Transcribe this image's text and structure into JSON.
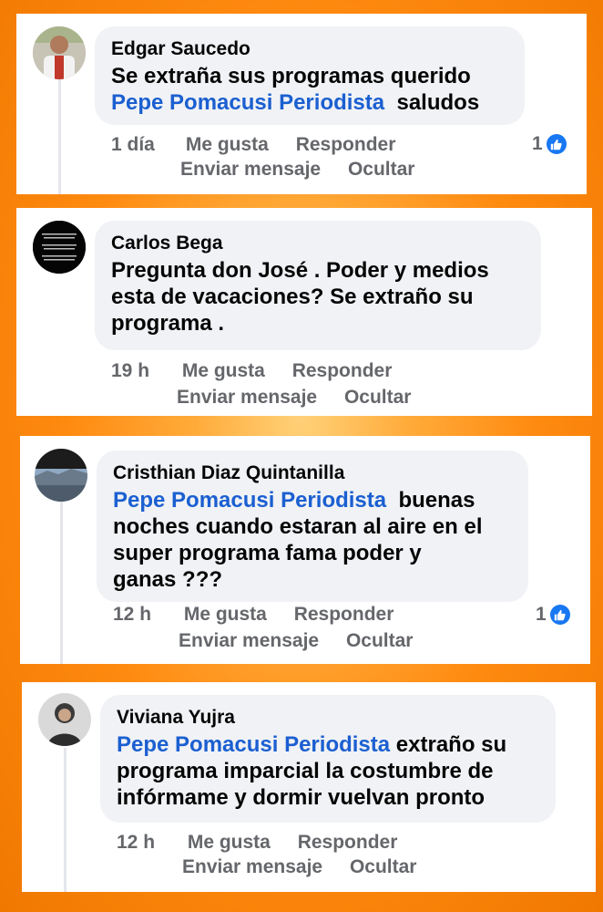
{
  "comments": [
    {
      "author": "Edgar Saucedo",
      "text_before": "Se extraña sus programas querido",
      "mention": "Pepe Pomacusi Periodista",
      "text_after": "saludos",
      "time": "1 día",
      "like": "Me gusta",
      "reply": "Responder",
      "send": "Enviar mensaje",
      "hide": "Ocultar",
      "reactions": "1"
    },
    {
      "author": "Carlos Bega",
      "text": "Pregunta don José . Poder y medios esta de vacaciones? Se extraño su programa .",
      "text_lines": [
        "Pregunta don José . Poder y medios",
        "esta de vacaciones? Se extraño su",
        "programa ."
      ],
      "time": "19 h",
      "like": "Me gusta",
      "reply": "Responder",
      "send": "Enviar mensaje",
      "hide": "Ocultar"
    },
    {
      "author": "Cristhian Diaz Quintanilla",
      "mention": "Pepe Pomacusi Periodista",
      "text_after_1": "buenas",
      "text_lines": [
        "noches cuando estaran al aire en el",
        "super programa fama poder y",
        "ganas ???"
      ],
      "time": "12 h",
      "like": "Me gusta",
      "reply": "Responder",
      "send": "Enviar mensaje",
      "hide": "Ocultar",
      "reactions": "1"
    },
    {
      "author": "Viviana Yujra",
      "mention": "Pepe Pomacusi Periodista",
      "text_after_1": "extraño su",
      "text_lines": [
        "programa imparcial la costumbre de",
        "infórmame y dormir vuelvan pronto"
      ],
      "time": "12 h",
      "like": "Me gusta",
      "reply": "Responder",
      "send": "Enviar mensaje",
      "hide": "Ocultar"
    }
  ],
  "colors": {
    "mention": "#1b5fd1",
    "like_badge": "#1877f2",
    "muted": "#65676b"
  }
}
